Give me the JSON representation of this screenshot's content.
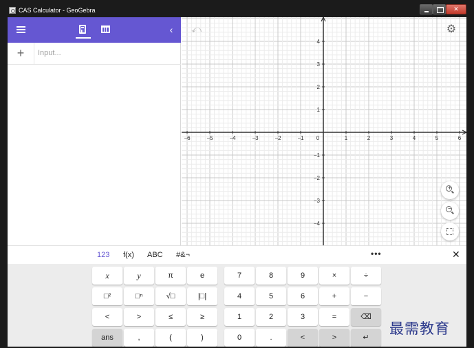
{
  "window": {
    "title": "CAS Calculator - GeoGebra",
    "close_glyph": "✕"
  },
  "algebra": {
    "collapse_glyph": "‹",
    "add_glyph": "+",
    "input_placeholder": "Input..."
  },
  "graphics": {
    "undo_glyph": "⤺",
    "settings_glyph": "⚙",
    "zoom_in_sign": "+",
    "zoom_out_sign": "−",
    "x_ticks": [
      "−6",
      "−5",
      "−4",
      "−3",
      "−2",
      "−1",
      "0",
      "1",
      "2",
      "3",
      "4",
      "5",
      "6"
    ],
    "y_ticks": [
      "4",
      "3",
      "2",
      "1",
      "−1",
      "−2",
      "−3",
      "−4"
    ],
    "x_range": [
      -6,
      6
    ],
    "y_range": [
      -5,
      5
    ],
    "grid": true
  },
  "keyboard": {
    "tabs": [
      "123",
      "f(x)",
      "ABC",
      "#&¬"
    ],
    "active_tab": "123",
    "more_label": "•••",
    "close_label": "✕",
    "rows": [
      [
        "x",
        "y",
        "π",
        "e",
        "7",
        "8",
        "9",
        "×",
        "÷"
      ],
      [
        "□²",
        "□ⁿ",
        "√□",
        "|□|",
        "4",
        "5",
        "6",
        "+",
        "−"
      ],
      [
        "<",
        ">",
        "≤",
        "≥",
        "1",
        "2",
        "3",
        "=",
        "⌫"
      ],
      [
        "ans",
        ",",
        "(",
        ")",
        "0",
        ".",
        "<",
        ">",
        "↵"
      ]
    ]
  },
  "watermark": "最需教育"
}
